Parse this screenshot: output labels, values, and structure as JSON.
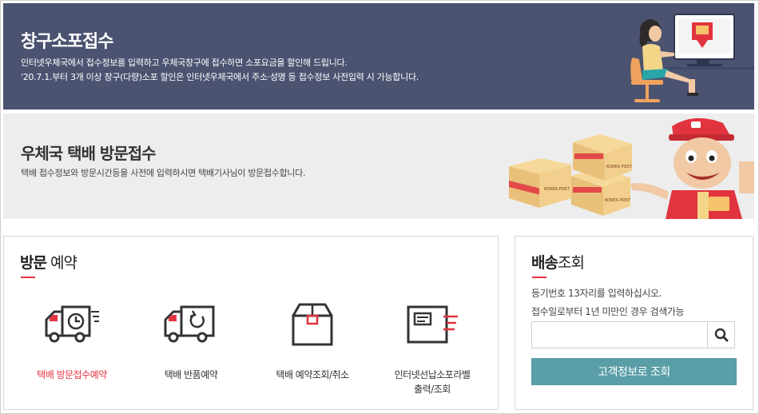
{
  "counter_banner": {
    "title": "창구소포접수",
    "line1": "인터넷우체국에서 접수정보를 입력하고 우체국창구에 접수하면 소포요금을 할인해 드립니다.",
    "line2": "'20.7.1.부터 3개 이상 창구(다량)소포 할인은 인터넷우체국에서 주소·성명 등 접수정보 사전입력 시 가능합니다."
  },
  "visit_banner": {
    "title": "우체국 택배 방문접수",
    "line1": "택배 접수정보와 방문시간등을 사전에 입력하시면 택배기사님이 방문접수합니다.",
    "box_label": "KOREA POST"
  },
  "visit_panel": {
    "title_bold": "방문",
    "title_light": " 예약",
    "services": [
      {
        "label": "택배 방문접수예약",
        "active": true
      },
      {
        "label": "택배 반품예약",
        "active": false
      },
      {
        "label": "택배 예약조회/취소",
        "active": false
      },
      {
        "label": "인터넷선납소포라벨",
        "label2": "출력/조회",
        "active": false
      }
    ]
  },
  "track_panel": {
    "title_bold": "배송",
    "title_light": "조회",
    "desc1": "등기번호 13자리를 입력하십시오.",
    "desc2": "접수일로부터 1년 미만인 경우 검색가능",
    "search_value": "",
    "search_placeholder": "",
    "customer_button": "고객정보로 조회"
  },
  "colors": {
    "banner_dark": "#4b5371",
    "banner_light": "#ededed",
    "accent_red": "#e2343f",
    "teal_button": "#5a9ea7"
  },
  "icons": [
    "truck-clock-icon",
    "truck-return-icon",
    "box-icon",
    "label-print-icon",
    "search-icon"
  ]
}
